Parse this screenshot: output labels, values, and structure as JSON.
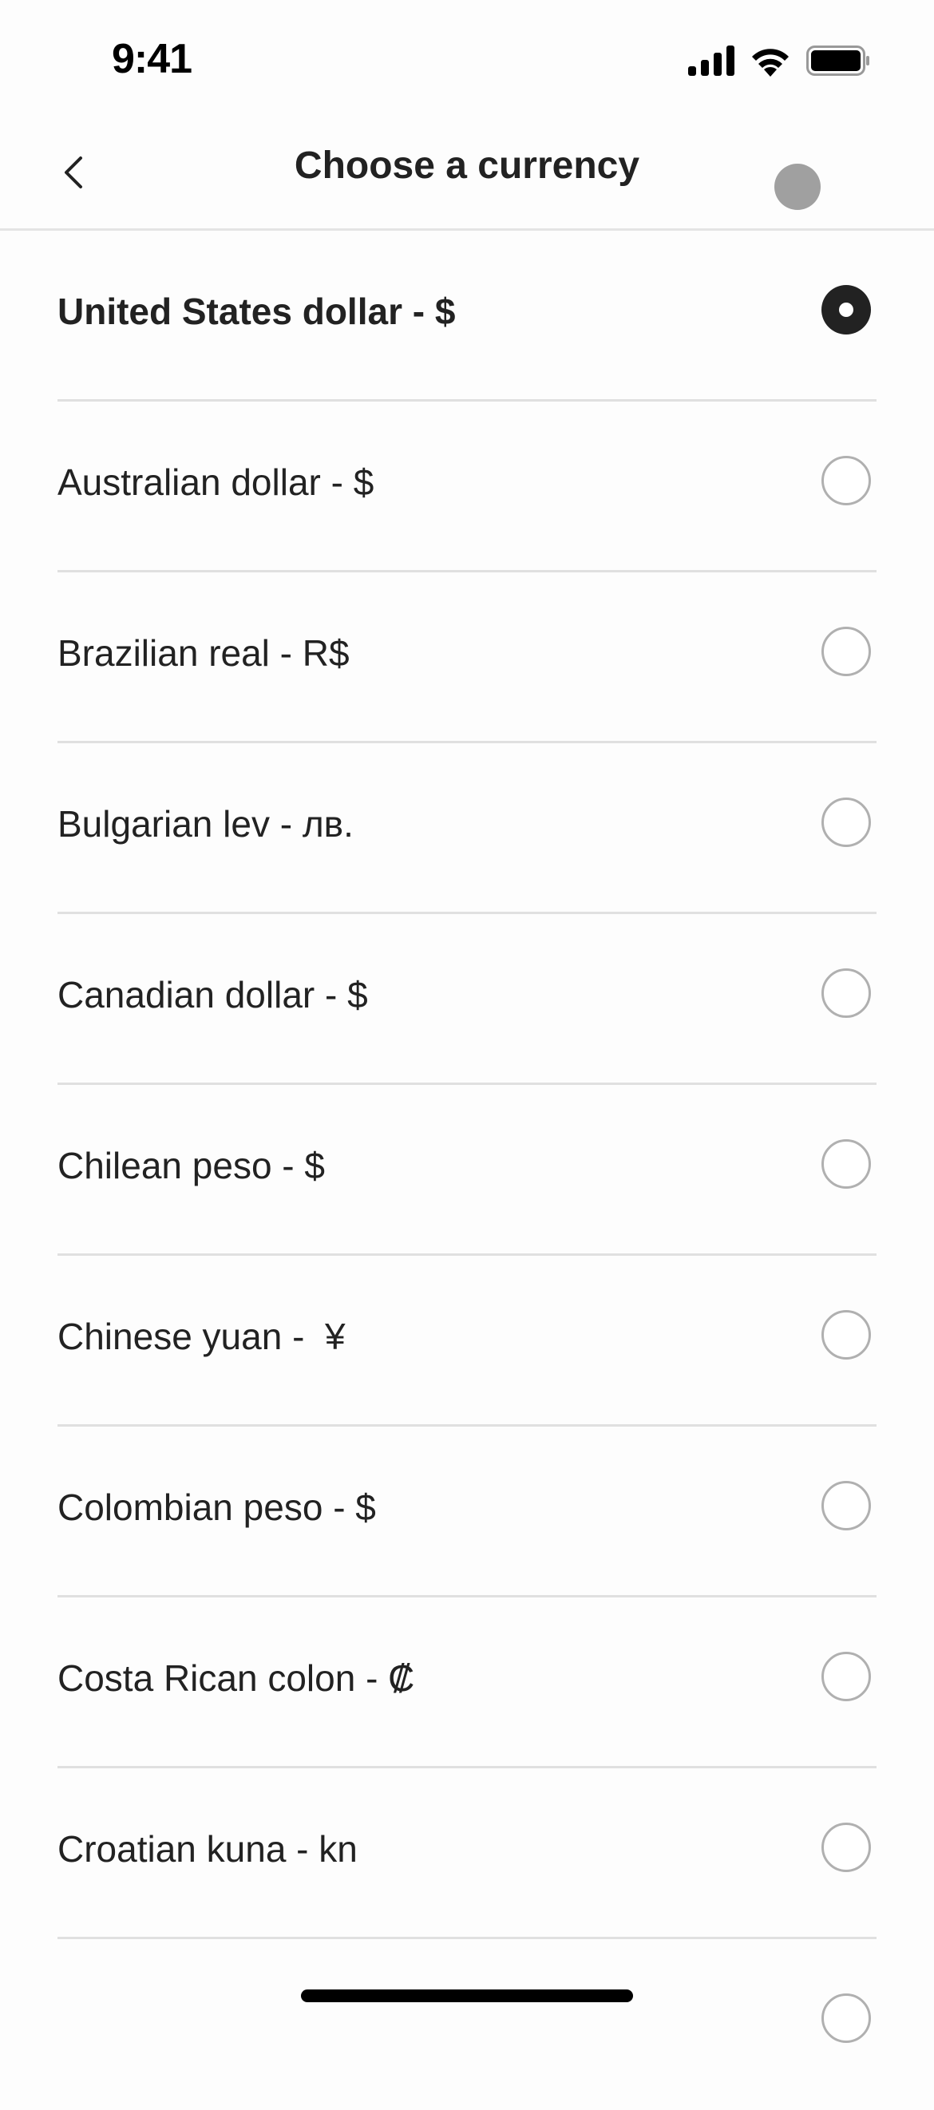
{
  "status_bar": {
    "time": "9:41",
    "icons": [
      "cellular-signal-icon",
      "wifi-icon",
      "battery-icon"
    ]
  },
  "header": {
    "title": "Choose a currency",
    "back_icon": "chevron-left-icon"
  },
  "currencies": [
    {
      "label": "United States dollar - $",
      "selected": true
    },
    {
      "label": "Australian dollar - $",
      "selected": false
    },
    {
      "label": "Brazilian real - R$",
      "selected": false
    },
    {
      "label": "Bulgarian lev - лв.",
      "selected": false
    },
    {
      "label": "Canadian dollar - $",
      "selected": false
    },
    {
      "label": "Chilean peso - $",
      "selected": false
    },
    {
      "label": "Chinese yuan -  ¥",
      "selected": false
    },
    {
      "label": "Colombian peso - $",
      "selected": false
    },
    {
      "label": "Costa Rican colon - ₡",
      "selected": false
    },
    {
      "label": "Croatian kuna - kn",
      "selected": false
    },
    {
      "label": "",
      "selected": false
    }
  ],
  "colors": {
    "text": "#222222",
    "selected_radio": "#222222",
    "unselected_radio_border": "#b0b0b0",
    "divider": "#e0e0e0"
  }
}
